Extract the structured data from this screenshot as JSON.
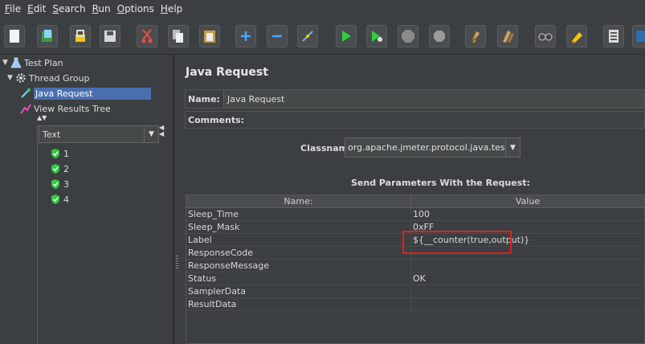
{
  "menu": [
    {
      "label": "File",
      "accel": "F",
      "rest": "ile"
    },
    {
      "label": "Edit",
      "accel": "E",
      "rest": "dit"
    },
    {
      "label": "Search",
      "accel": "S",
      "rest": "earch"
    },
    {
      "label": "Run",
      "accel": "R",
      "rest": "un"
    },
    {
      "label": "Options",
      "accel": "O",
      "rest": "ptions"
    },
    {
      "label": "Help",
      "accel": "H",
      "rest": "elp"
    }
  ],
  "toolbar_icons": [
    "new-icon",
    "templates-icon",
    "open-icon",
    "save-icon",
    "cut-icon",
    "copy-icon",
    "paste-icon",
    "expand-icon",
    "collapse-icon",
    "toggle-icon",
    "start-icon",
    "start-no-pause-icon",
    "stop-icon",
    "shutdown-icon",
    "clear-icon",
    "clear-all-icon",
    "search-icon",
    "reset-search-icon",
    "function-helper-icon",
    "help-icon"
  ],
  "tree": {
    "test_plan": "Test Plan",
    "thread_group": "Thread Group",
    "java_request": "Java Request",
    "view_results_tree": "View Results Tree"
  },
  "results": {
    "renderer": "Text",
    "items": [
      "1",
      "2",
      "3",
      "4"
    ]
  },
  "panel": {
    "title": "Java Request",
    "name_label": "Name:",
    "name_value": "Java Request",
    "comments_label": "Comments:",
    "classname_label": "Classname:",
    "classname_value": "org.apache.jmeter.protocol.java.test.JavaTest",
    "send_label": "Send Parameters With the Request:",
    "col_name": "Name:",
    "col_value": "Value",
    "rows": [
      {
        "name": "Sleep_Time",
        "value": "100"
      },
      {
        "name": "Sleep_Mask",
        "value": "0xFF"
      },
      {
        "name": "Label",
        "value": "${__counter(true,output)}"
      },
      {
        "name": "ResponseCode",
        "value": ""
      },
      {
        "name": "ResponseMessage",
        "value": ""
      },
      {
        "name": "Status",
        "value": "OK"
      },
      {
        "name": "SamplerData",
        "value": ""
      },
      {
        "name": "ResultData",
        "value": ""
      }
    ]
  },
  "colors": {
    "background": "#3c3f41",
    "selection": "#4b6eaf",
    "highlight_box": "#e02020"
  }
}
